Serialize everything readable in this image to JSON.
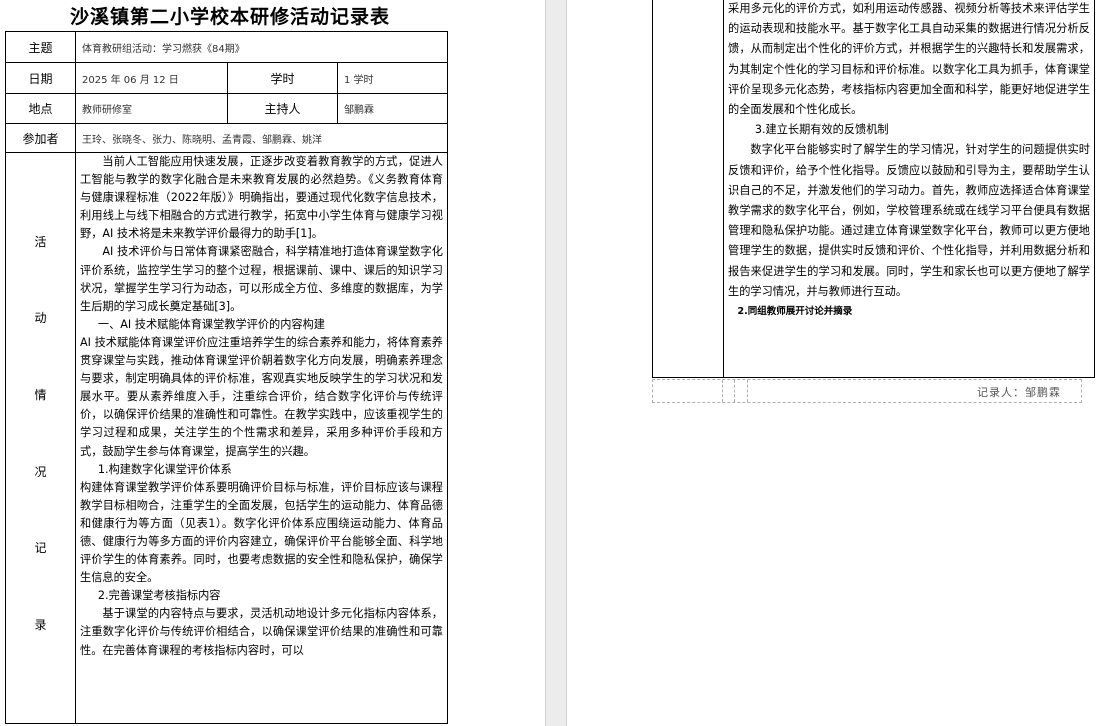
{
  "title": "沙溪镇第二小学校本研修活动记录表",
  "table": {
    "topic_label": "主题",
    "topic_value": "体育教研组活动：学习燃获《84期》",
    "date_label": "日期",
    "date_value": "2025 年 06 月 12 日",
    "hours_label": "学时",
    "hours_value": "1 学时",
    "place_label": "地点",
    "place_value": "教师研修室",
    "host_label": "主持人",
    "host_value": "邹鹏霖",
    "participants_label": "参加者",
    "participants_value": "王玲、张晓冬、张力、陈晓明、孟青霞、邹鹏霖、姚洋",
    "record_label_chars": [
      "活",
      "动",
      "情",
      "况",
      "记",
      "录"
    ]
  },
  "left_content": [
    "当前人工智能应用快速发展，正逐步改变着教育教学的方式，促进人工智能与教学的数字化融合是未来教育发展的必然趋势。《义务教育体育与健康课程标准（2022年版）》明确指出，要通过现代化数字信息技术，利用线上与线下相融合的方式进行教学，拓宽中小学生体育与健康学习视野，AI 技术将是未来教学评价最得力的助手[1]。",
    "AI 技术评价与日常体育课紧密融合，科学精准地打造体育课堂数字化评价系统，监控学生学习的整个过程，根据课前、课中、课后的知识学习状况，掌握学生学习行为动态，可以形成全方位、多维度的数据库，为学生后期的学习成长奠定基础[3]。",
    "一、AI 技术赋能体育课堂教学评价的内容构建",
    "AI 技术赋能体育课堂评价应注重培养学生的综合素养和能力，将体育素养贯穿课堂与实践，推动体育课堂评价朝着数字化方向发展，明确素养理念与要求，制定明确具体的评价标准，客观真实地反映学生的学习状况和发展水平。要从素养维度入手，注重综合评价，结合数字化评价与传统评价，以确保评价结果的准确性和可靠性。在教学实践中，应该重视学生的学习过程和成果，关注学生的个性需求和差异，采用多种评价手段和方式，鼓励学生参与体育课堂，提高学生的兴趣。",
    "1.构建数字化课堂评价体系",
    "构建体育课堂教学评价体系要明确评价目标与标准，评价目标应该与课程教学目标相吻合，注重学生的全面发展，包括学生的运动能力、体育品德和健康行为等方面（见表1）。数字化评价体系应围绕运动能力、体育品德、健康行为等多方面的评价内容建立，确保评价平台能够全面、科学地评价学生的体育素养。同时，也要考虑数据的安全性和隐私保护，确保学生信息的安全。",
    "2.完善课堂考核指标内容",
    "基于课堂的内容特点与要求，灵活机动地设计多元化指标内容体系，注重数字化评价与传统评价相结合，以确保课堂评价结果的准确性和可靠性。在完善体育课程的考核指标内容时，可以"
  ],
  "right_content": [
    "采用多元化的评价方式，如利用运动传感器、视频分析等技术来评估学生的运动表现和技能水平。基于数字化工具自动采集的数据进行情况分析反馈，从而制定出个性化的评价方式，并根据学生的兴趣特长和发展需求，为其制定个性化的学习目标和评价标准。以数字化工具为抓手，体育课堂评价呈现多元化态势，考核指标内容更加全面和科学，能更好地促进学生的全面发展和个性化成长。",
    "3.建立长期有效的反馈机制",
    "数字化平台能够实时了解学生的学习情况，针对学生的问题提供实时反馈和评价，给予个性化指导。反馈应以鼓励和引导为主，要帮助学生认识自己的不足，并激发他们的学习动力。首先，教师应选择适合体育课堂教学需求的数字化平台，例如，学校管理系统或在线学习平台便具有数据管理和隐私保护功能。通过建立体育课堂数字化平台，教师可以更方便地管理学生的数据，提供实时反馈和评价、个性化指导，并利用数据分析和报告来促进学生的学习和发展。同时，学生和家长也可以更方便地了解学生的学习情况，并与教师进行互动。",
    "2.同组教师展开讨论并摘录"
  ],
  "recorder": "记录人：邹鹏霖"
}
